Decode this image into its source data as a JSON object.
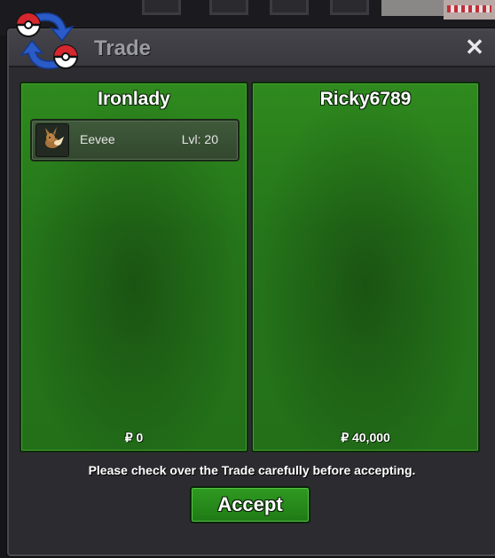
{
  "window": {
    "title": "Trade",
    "close_icon": "close-icon"
  },
  "left_trader": {
    "name": "Ironlady",
    "items": [
      {
        "icon": "eevee-sprite-icon",
        "name": "Eevee",
        "level": "Lvl: 20"
      }
    ],
    "money": "₽ 0"
  },
  "right_trader": {
    "name": "Ricky6789",
    "items": [],
    "money": "₽ 40,000"
  },
  "notice": "Please check over the Trade carefully before accepting.",
  "accept_label": "Accept",
  "colors": {
    "panel_green": "#2a7f1c",
    "accent_green": "#2f9a21",
    "window_bg": "#2c2b30"
  }
}
